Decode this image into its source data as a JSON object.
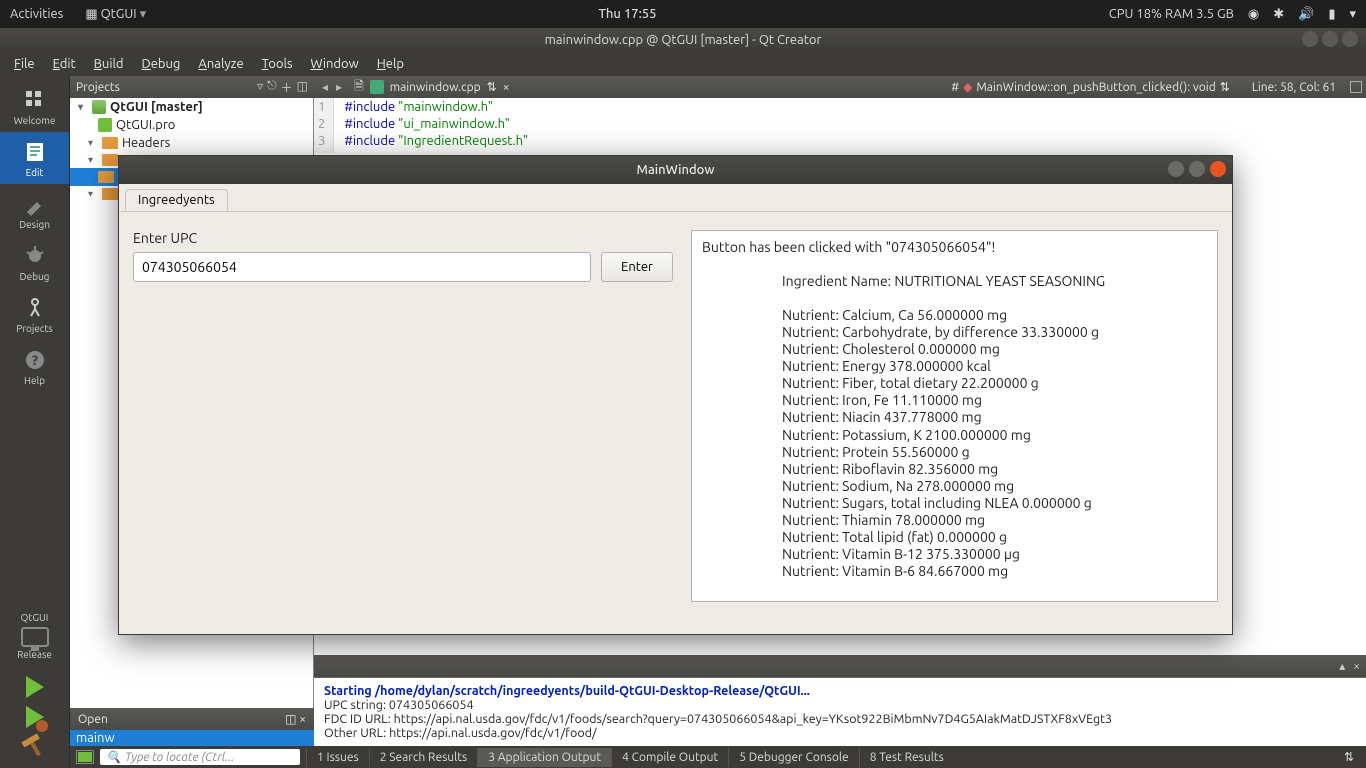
{
  "ubuntu": {
    "activities": "Activities",
    "app": "QtGUI",
    "clock": "Thu 17:55",
    "sys": "CPU 18% RAM 3.5 GB"
  },
  "qtc": {
    "title": "mainwindow.cpp @ QtGUI [master] - Qt Creator",
    "menu": [
      "File",
      "Edit",
      "Build",
      "Debug",
      "Analyze",
      "Tools",
      "Window",
      "Help"
    ],
    "sidebar": {
      "items": [
        "Welcome",
        "Edit",
        "Design",
        "Debug",
        "Projects",
        "Help"
      ],
      "active": 1,
      "kit_name": "QtGUI",
      "kit_mode": "Release"
    },
    "projects_label": "Projects",
    "tree": {
      "root": "QtGUI [master]",
      "pro": "QtGUI.pro",
      "headers": "Headers"
    },
    "open_docs_label": "Open",
    "open_docs": [
      "mainw"
    ],
    "editor": {
      "filename": "mainwindow.cpp",
      "crumb": "MainWindow::on_pushButton_clicked(): void",
      "line_col": "Line: 58, Col: 61",
      "lines": [
        {
          "n": "1",
          "pre": "#include ",
          "str": "\"mainwindow.h\""
        },
        {
          "n": "2",
          "pre": "#include ",
          "str": "\"ui_mainwindow.h\""
        },
        {
          "n": "3",
          "pre": "#include ",
          "str": "\"IngredientRequest.h\""
        }
      ]
    },
    "output": {
      "start": "Starting /home/dylan/scratch/ingreedyents/build-QtGUI-Desktop-Release/QtGUI...",
      "l1": "UPC string: 074305066054",
      "l2": "FDC ID URL: https://api.nal.usda.gov/fdc/v1/foods/search?query=074305066054&api_key=YKsot922BiMbmNv7D4G5AIakMatDJSTXF8xVEgt3",
      "l3": "Other URL: https://api.nal.usda.gov/fdc/v1/food/"
    },
    "status": {
      "search_placeholder": "Type to locate (Ctrl...",
      "tabs": [
        "1  Issues",
        "2  Search Results",
        "3  Application Output",
        "4  Compile Output",
        "5  Debugger Console",
        "8  Test Results"
      ],
      "active_tab": 2
    }
  },
  "mainwin": {
    "title": "MainWindow",
    "tab": "Ingreedyents",
    "label": "Enter UPC",
    "input_value": "074305066054",
    "button": "Enter",
    "result_header": "Button has been clicked with \"074305066054\"!",
    "ingredient_name": "Ingredient Name: NUTRITIONAL YEAST SEASONING",
    "nutrients": [
      "Nutrient: Calcium, Ca 56.000000 mg",
      "Nutrient: Carbohydrate, by difference 33.330000 g",
      "Nutrient: Cholesterol 0.000000 mg",
      "Nutrient: Energy 378.000000 kcal",
      "Nutrient: Fiber, total dietary 22.200000 g",
      "Nutrient: Iron, Fe 11.110000 mg",
      "Nutrient: Niacin 437.778000 mg",
      "Nutrient: Potassium, K 2100.000000 mg",
      "Nutrient: Protein 55.560000 g",
      "Nutrient: Riboflavin 82.356000 mg",
      "Nutrient: Sodium, Na 278.000000 mg",
      "Nutrient: Sugars, total including NLEA 0.000000 g",
      "Nutrient: Thiamin 78.000000 mg",
      "Nutrient: Total lipid (fat) 0.000000 g",
      "Nutrient: Vitamin B-12 375.330000 µg",
      "Nutrient: Vitamin B-6 84.667000 mg"
    ]
  }
}
